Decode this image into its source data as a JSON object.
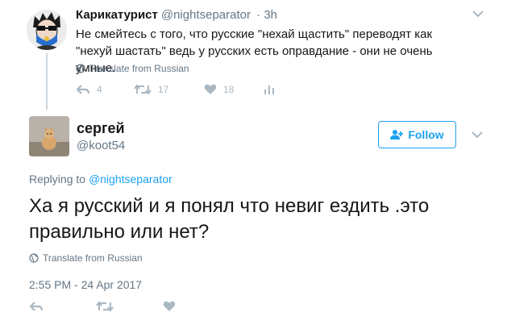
{
  "tweet": {
    "author_name": "Карикатурист",
    "author_handle": "@nightseparator",
    "time": "· 3h",
    "text": "Не смейтесь с того, что русские \"нехай щастить\" переводят как \"нехуй шастать\" ведь у русских есть оправдание - они не очень умные.",
    "translate_label": "Translate from Russian",
    "reply_count": "4",
    "retweet_count": "17",
    "like_count": "18"
  },
  "reply": {
    "author_name": "сергей",
    "author_handle": "@koot54",
    "follow_label": "Follow",
    "replying_prefix": "Replying to",
    "replying_handle": "@nightseparator",
    "text": "Ха я русский и я понял что невиг ездить .это правильно или нет?",
    "translate_label": "Translate from Russian",
    "timestamp": "2:55 PM - 24 Apr 2017"
  },
  "colors": {
    "accent": "#1da1f2",
    "muted_text": "#657786",
    "icon_gray": "#aab8c2"
  }
}
